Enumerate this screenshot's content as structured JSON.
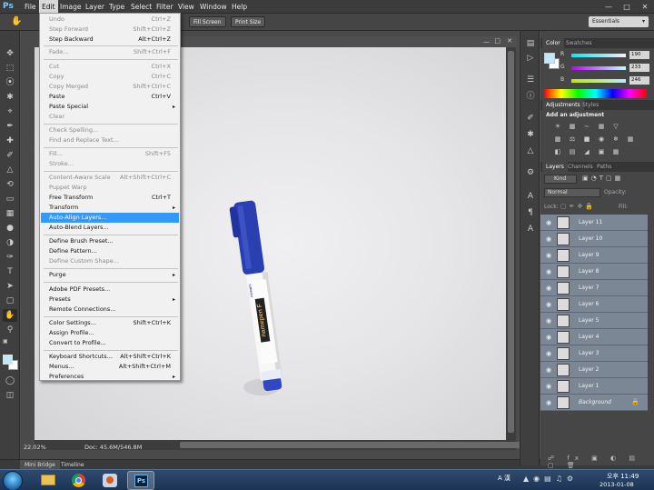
{
  "app": {
    "logo": "Ps"
  },
  "menubar": {
    "items": [
      "File",
      "Edit",
      "Image",
      "Layer",
      "Type",
      "Select",
      "Filter",
      "View",
      "Window",
      "Help"
    ],
    "active": "Edit"
  },
  "options": {
    "fill_screen": "Fill Screen",
    "print_size": "Print Size",
    "workspace": "Essentials"
  },
  "edit_menu": {
    "items": [
      {
        "label": "Undo",
        "shortcut": "Ctrl+Z",
        "state": "disabled"
      },
      {
        "label": "Step Forward",
        "shortcut": "Shift+Ctrl+Z",
        "state": "disabled"
      },
      {
        "label": "Step Backward",
        "shortcut": "Alt+Ctrl+Z",
        "state": "enabled"
      },
      {
        "label": "Fade...",
        "shortcut": "Shift+Ctrl+F",
        "state": "disabled"
      },
      {
        "label": "Cut",
        "shortcut": "Ctrl+X",
        "state": "disabled"
      },
      {
        "label": "Copy",
        "shortcut": "Ctrl+C",
        "state": "disabled"
      },
      {
        "label": "Copy Merged",
        "shortcut": "Shift+Ctrl+C",
        "state": "disabled"
      },
      {
        "label": "Paste",
        "shortcut": "Ctrl+V",
        "state": "enabled"
      },
      {
        "label": "Paste Special",
        "shortcut": "",
        "state": "enabled",
        "submenu": true
      },
      {
        "label": "Clear",
        "shortcut": "",
        "state": "disabled"
      },
      {
        "label": "Check Spelling...",
        "shortcut": "",
        "state": "disabled"
      },
      {
        "label": "Find and Replace Text...",
        "shortcut": "",
        "state": "disabled"
      },
      {
        "label": "Fill...",
        "shortcut": "Shift+F5",
        "state": "disabled"
      },
      {
        "label": "Stroke...",
        "shortcut": "",
        "state": "disabled"
      },
      {
        "label": "Content-Aware Scale",
        "shortcut": "Alt+Shift+Ctrl+C",
        "state": "disabled"
      },
      {
        "label": "Puppet Warp",
        "shortcut": "",
        "state": "disabled"
      },
      {
        "label": "Free Transform",
        "shortcut": "Ctrl+T",
        "state": "enabled"
      },
      {
        "label": "Transform",
        "shortcut": "",
        "state": "enabled",
        "submenu": true
      },
      {
        "label": "Auto-Align Layers...",
        "shortcut": "",
        "state": "highlight"
      },
      {
        "label": "Auto-Blend Layers...",
        "shortcut": "",
        "state": "enabled"
      },
      {
        "label": "Define Brush Preset...",
        "shortcut": "",
        "state": "enabled"
      },
      {
        "label": "Define Pattern...",
        "shortcut": "",
        "state": "enabled"
      },
      {
        "label": "Define Custom Shape...",
        "shortcut": "",
        "state": "disabled"
      },
      {
        "label": "Purge",
        "shortcut": "",
        "state": "enabled",
        "submenu": true
      },
      {
        "label": "Adobe PDF Presets...",
        "shortcut": "",
        "state": "enabled"
      },
      {
        "label": "Presets",
        "shortcut": "",
        "state": "enabled",
        "submenu": true
      },
      {
        "label": "Remote Connections...",
        "shortcut": "",
        "state": "enabled"
      },
      {
        "label": "Color Settings...",
        "shortcut": "Shift+Ctrl+K",
        "state": "enabled"
      },
      {
        "label": "Assign Profile...",
        "shortcut": "",
        "state": "enabled"
      },
      {
        "label": "Convert to Profile...",
        "shortcut": "",
        "state": "enabled"
      },
      {
        "label": "Keyboard Shortcuts...",
        "shortcut": "Alt+Shift+Ctrl+K",
        "state": "enabled"
      },
      {
        "label": "Menus...",
        "shortcut": "Alt+Shift+Ctrl+M",
        "state": "enabled"
      },
      {
        "label": "Preferences",
        "shortcut": "",
        "state": "enabled",
        "submenu": true
      }
    ]
  },
  "status": {
    "zoom": "22.02%",
    "doc": "Doc: 45.6M/546.8M"
  },
  "bottom_tabs": [
    "Mini Bridge",
    "Timeline"
  ],
  "color_panel": {
    "tabs": [
      "Color",
      "Swatches"
    ],
    "r": "190",
    "g": "233",
    "b": "246",
    "r_label": "R",
    "g_label": "G",
    "b_label": "B",
    "fg_color": "#bee9f6"
  },
  "adjustments_panel": {
    "tabs": [
      "Adjustments",
      "Styles"
    ],
    "heading": "Add an adjustment"
  },
  "layers_panel": {
    "tabs": [
      "Layers",
      "Channels",
      "Paths"
    ],
    "filter": "Kind",
    "blend_mode": "Normal",
    "opacity_label": "Opacity:",
    "fill_label": "Fill:",
    "lock_label": "Lock:",
    "layers": [
      "Layer 11",
      "Layer 10",
      "Layer 9",
      "Layer 8",
      "Layer 7",
      "Layer 6",
      "Layer 5",
      "Layer 4",
      "Layer 3",
      "Layer 2",
      "Layer 1",
      "Background"
    ]
  },
  "pen_label": {
    "brand": "monami",
    "name": "namepen F"
  },
  "taskbar": {
    "ime": "A 漢",
    "time": "오후 11:49",
    "date": "2013-01-08"
  },
  "colors": {
    "menu_highlight": "#3399ff",
    "layer_row": "#7c8796",
    "pen_blue": "#2a3fb0"
  }
}
